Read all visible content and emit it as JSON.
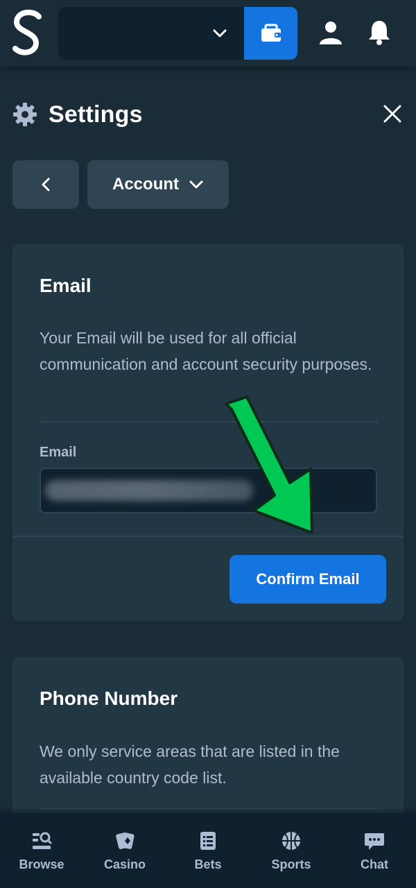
{
  "header": {
    "logo_icon": "stake-s-logo",
    "wallet_icon": "wallet-icon",
    "user_icon": "user-icon",
    "notifications_icon": "bell-icon",
    "colors": {
      "bar": "#1a2c38",
      "balance_bg": "#0f212e",
      "accent": "#1475e1"
    }
  },
  "settings": {
    "title": "Settings",
    "icon": "gear-icon",
    "close_icon": "close-icon"
  },
  "nav": {
    "back_icon": "chevron-left-icon",
    "section_label": "Account",
    "section_icon": "chevron-down-icon"
  },
  "email_card": {
    "title": "Email",
    "description": "Your Email will be used for all official communication and account security purposes.",
    "field_label": "Email",
    "confirm_label": "Confirm Email"
  },
  "phone_card": {
    "title": "Phone Number",
    "description": "We only service areas that are listed in the available country code list."
  },
  "bottom_nav": {
    "items": [
      {
        "label": "Browse",
        "icon": "browse-icon"
      },
      {
        "label": "Casino",
        "icon": "cards-icon"
      },
      {
        "label": "Bets",
        "icon": "bets-list-icon"
      },
      {
        "label": "Sports",
        "icon": "basketball-icon"
      },
      {
        "label": "Chat",
        "icon": "chat-icon"
      }
    ]
  },
  "annotation": {
    "arrow_color": "#00c853"
  }
}
